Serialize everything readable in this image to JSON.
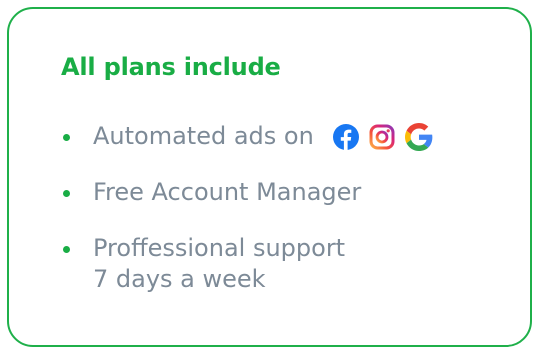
{
  "card": {
    "title": "All plans include",
    "items": [
      {
        "text": "Automated ads on",
        "icons": [
          "facebook-icon",
          "instagram-icon",
          "google-icon"
        ]
      },
      {
        "text": "Free Account Manager"
      },
      {
        "line1": "Proffessional support",
        "line2": "7 days a week"
      }
    ]
  },
  "colors": {
    "accent": "#19ad45",
    "text": "#7d8a97",
    "border": "#1fb04a"
  }
}
